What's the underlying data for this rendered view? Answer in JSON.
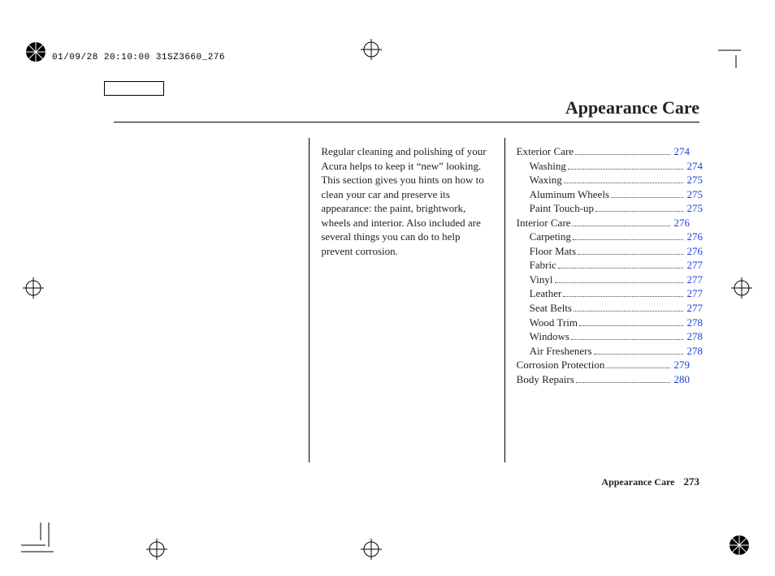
{
  "stamp": "01/09/28 20:10:00 31SZ3660_276",
  "title": "Appearance Care",
  "intro": "Regular cleaning and polishing of your Acura helps to keep it “new” looking. This section gives you hints on how to clean your car and preserve its appearance: the paint, brightwork, wheels and interior. Also included are several things you can do to help prevent corrosion.",
  "toc": [
    {
      "label": "Exterior Care",
      "page": "274",
      "indent": 0
    },
    {
      "label": "Washing",
      "page": "274",
      "indent": 1
    },
    {
      "label": "Waxing",
      "page": "275",
      "indent": 1
    },
    {
      "label": "Aluminum Wheels",
      "page": "275",
      "indent": 1
    },
    {
      "label": "Paint Touch-up",
      "page": "275",
      "indent": 1
    },
    {
      "label": "Interior Care",
      "page": "276",
      "indent": 0
    },
    {
      "label": "Carpeting",
      "page": "276",
      "indent": 1
    },
    {
      "label": "Floor Mats",
      "page": "276",
      "indent": 1
    },
    {
      "label": "Fabric",
      "page": "277",
      "indent": 1
    },
    {
      "label": "Vinyl",
      "page": "277",
      "indent": 1
    },
    {
      "label": "Leather",
      "page": "277",
      "indent": 1
    },
    {
      "label": "Seat Belts",
      "page": "277",
      "indent": 1
    },
    {
      "label": "Wood Trim",
      "page": "278",
      "indent": 1
    },
    {
      "label": "Windows",
      "page": "278",
      "indent": 1
    },
    {
      "label": "Air Fresheners",
      "page": "278",
      "indent": 1
    },
    {
      "label": "Corrosion Protection",
      "page": "279",
      "indent": 0
    },
    {
      "label": "Body Repairs",
      "page": "280",
      "indent": 0
    }
  ],
  "footer": {
    "section": "Appearance Care",
    "page": "273"
  }
}
